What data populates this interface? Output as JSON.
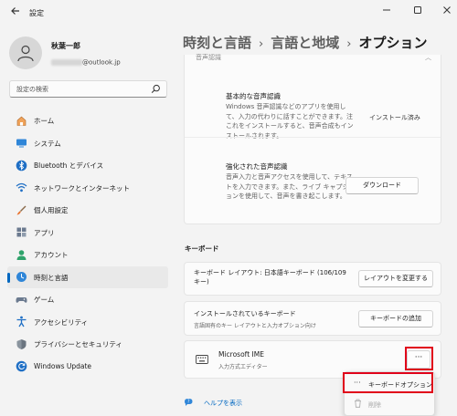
{
  "window": {
    "title": "設定",
    "back_icon": "back-arrow-icon",
    "minimize_icon": "minimize-icon",
    "maximize_icon": "maximize-icon",
    "close_icon": "close-icon"
  },
  "user": {
    "name": "秋葉一郎",
    "email_suffix": "@outlook.jp"
  },
  "search": {
    "placeholder": "設定の検索"
  },
  "sidebar": {
    "items": [
      {
        "label": "ホーム",
        "icon": "home-icon",
        "active": false
      },
      {
        "label": "システム",
        "icon": "system-icon",
        "active": false
      },
      {
        "label": "Bluetooth とデバイス",
        "icon": "bluetooth-icon",
        "active": false
      },
      {
        "label": "ネットワークとインターネット",
        "icon": "wifi-icon",
        "active": false
      },
      {
        "label": "個人用設定",
        "icon": "brush-icon",
        "active": false
      },
      {
        "label": "アプリ",
        "icon": "apps-icon",
        "active": false
      },
      {
        "label": "アカウント",
        "icon": "account-icon",
        "active": false
      },
      {
        "label": "時刻と言語",
        "icon": "time-language-icon",
        "active": true
      },
      {
        "label": "ゲーム",
        "icon": "gamepad-icon",
        "active": false
      },
      {
        "label": "アクセシビリティ",
        "icon": "accessibility-icon",
        "active": false
      },
      {
        "label": "プライバシーとセキュリティ",
        "icon": "shield-icon",
        "active": false
      },
      {
        "label": "Windows Update",
        "icon": "update-icon",
        "active": false
      }
    ]
  },
  "breadcrumb": {
    "items": [
      "時刻と言語",
      "言語と地域"
    ],
    "separator": "›",
    "current": "オプション"
  },
  "speech": {
    "header": "音声認識",
    "basic": {
      "title": "基本的な音声認識",
      "desc": "Windows 音声認識などのアプリを使用して、入力の代わりに話すことができます。注これをインストールすると、音声合成もインストールされます。",
      "status": "インストール済み"
    },
    "enhanced": {
      "title": "強化された音声認識",
      "desc": "音声入力と音声アクセスを使用して、テキストを入力できます。また、ライブ キャプションを使用して、音声を書き起こします。",
      "button": "ダウンロード"
    }
  },
  "keyboard": {
    "section_title": "キーボード",
    "layout": {
      "title": "キーボード レイアウト: 日本語キーボード (106/109 キー)",
      "button": "レイアウトを変更する"
    },
    "installed": {
      "title": "インストールされているキーボード",
      "subtitle": "言語固有のキー レイアウトと入力オプション向け",
      "button": "キーボードの追加"
    },
    "ime": {
      "title": "Microsoft IME",
      "subtitle": "入力方式エディター",
      "more": "···"
    }
  },
  "context_menu": {
    "items": [
      {
        "label": "キーボードオプション",
        "icon": "more-dots-icon",
        "glyph": "···",
        "disabled": false
      },
      {
        "label": "削除",
        "icon": "trash-icon",
        "glyph": "🗑",
        "disabled": true
      }
    ]
  },
  "help": {
    "label": "ヘルプを表示"
  },
  "colors": {
    "accent": "#0067c0",
    "highlight_box": "#e0001a",
    "background": "#f3f3f3",
    "card": "#fbfbfb"
  }
}
